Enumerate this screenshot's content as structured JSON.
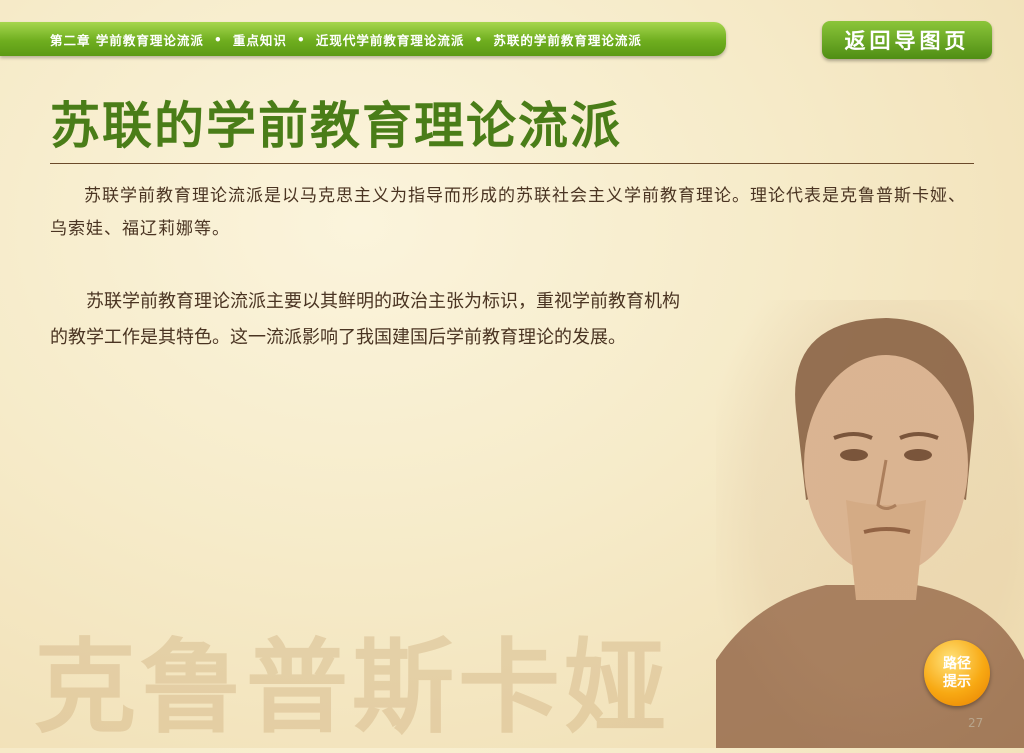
{
  "breadcrumb": {
    "items": [
      "第二章 学前教育理论流派",
      "重点知识",
      "近现代学前教育理论流派",
      "苏联的学前教育理论流派"
    ],
    "separator": "•"
  },
  "back_button": {
    "label": "返回导图页"
  },
  "page_title": "苏联的学前教育理论流派",
  "paragraphs": [
    "苏联学前教育理论流派是以马克思主义为指导而形成的苏联社会主义学前教育理论。理论代表是克鲁普斯卡娅、乌索娃、福辽莉娜等。",
    "苏联学前教育理论流派主要以其鲜明的政治主张为标识，重视学前教育机构的教学工作是其特色。这一流派影响了我国建国后学前教育理论的发展。"
  ],
  "watermark_text": "克鲁普斯卡娅",
  "hint_button": {
    "line1": "路径",
    "line2": "提示"
  },
  "page_number": "27",
  "colors": {
    "accent_green": "#6fae1f",
    "title_green": "#4a7d18",
    "hint_orange": "#f8a913",
    "text_brown": "#4a3422"
  }
}
